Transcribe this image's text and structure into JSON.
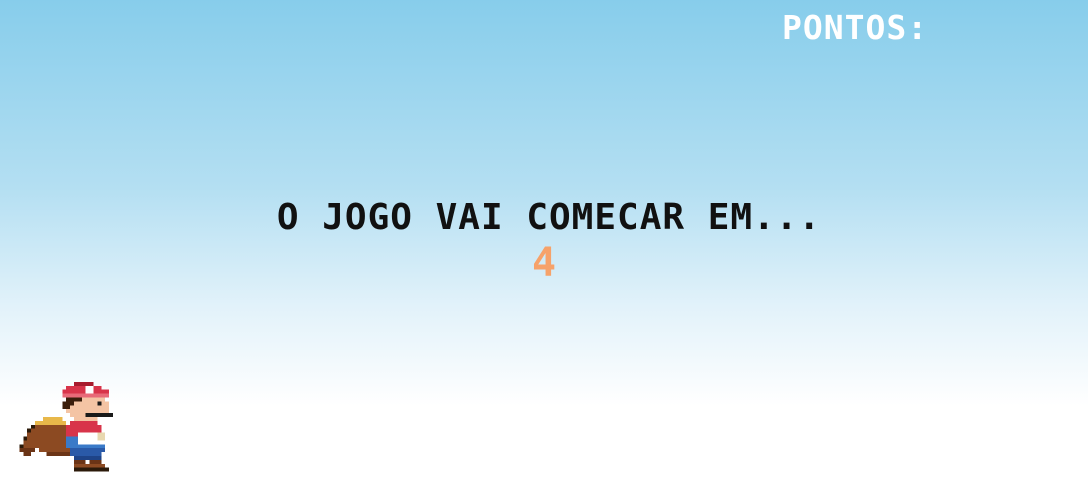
{
  "hud": {
    "score_label": "PONTOS:",
    "score_value": ""
  },
  "countdown": {
    "message": "O JOGO VAI COMECAR EM...",
    "number": "4"
  },
  "player": {
    "sprite": "cape-mario-sprite"
  },
  "colors": {
    "sky_top": "#87cdeb",
    "ground": "#ffffff",
    "countdown_number": "#f6a26a",
    "message_text": "#111111",
    "hud_text": "#ffffff"
  }
}
